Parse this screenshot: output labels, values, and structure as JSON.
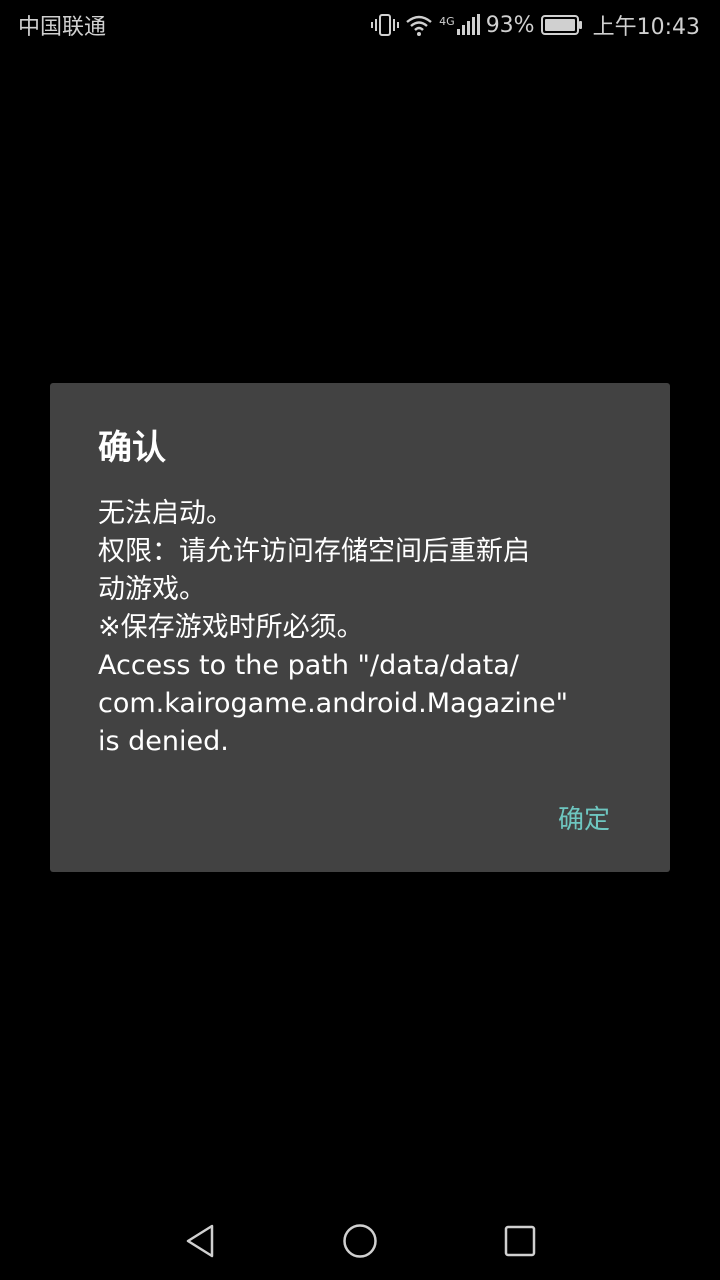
{
  "status_bar": {
    "carrier": "中国联通",
    "network": "4G",
    "battery_percent": "93%",
    "time": "上午10:43",
    "icons": [
      "vibrate-icon",
      "wifi-icon",
      "signal-icon",
      "battery-icon"
    ]
  },
  "dialog": {
    "title": "确认",
    "message_lines": [
      "无法启动。",
      "权限：请允许访问存储空间后重新启",
      "动游戏。",
      "※保存游戏时所必须。",
      "Access to the path \"/data/data/",
      "com.kairogame.android.Magazine\"",
      "is denied."
    ],
    "ok_button": "确定"
  },
  "nav_bar": {
    "icons": [
      "back-icon",
      "home-icon",
      "recents-icon"
    ]
  },
  "colors": {
    "background": "#000000",
    "dialog_bg": "#424242",
    "accent": "#6ec6c0",
    "text": "#ffffff"
  }
}
